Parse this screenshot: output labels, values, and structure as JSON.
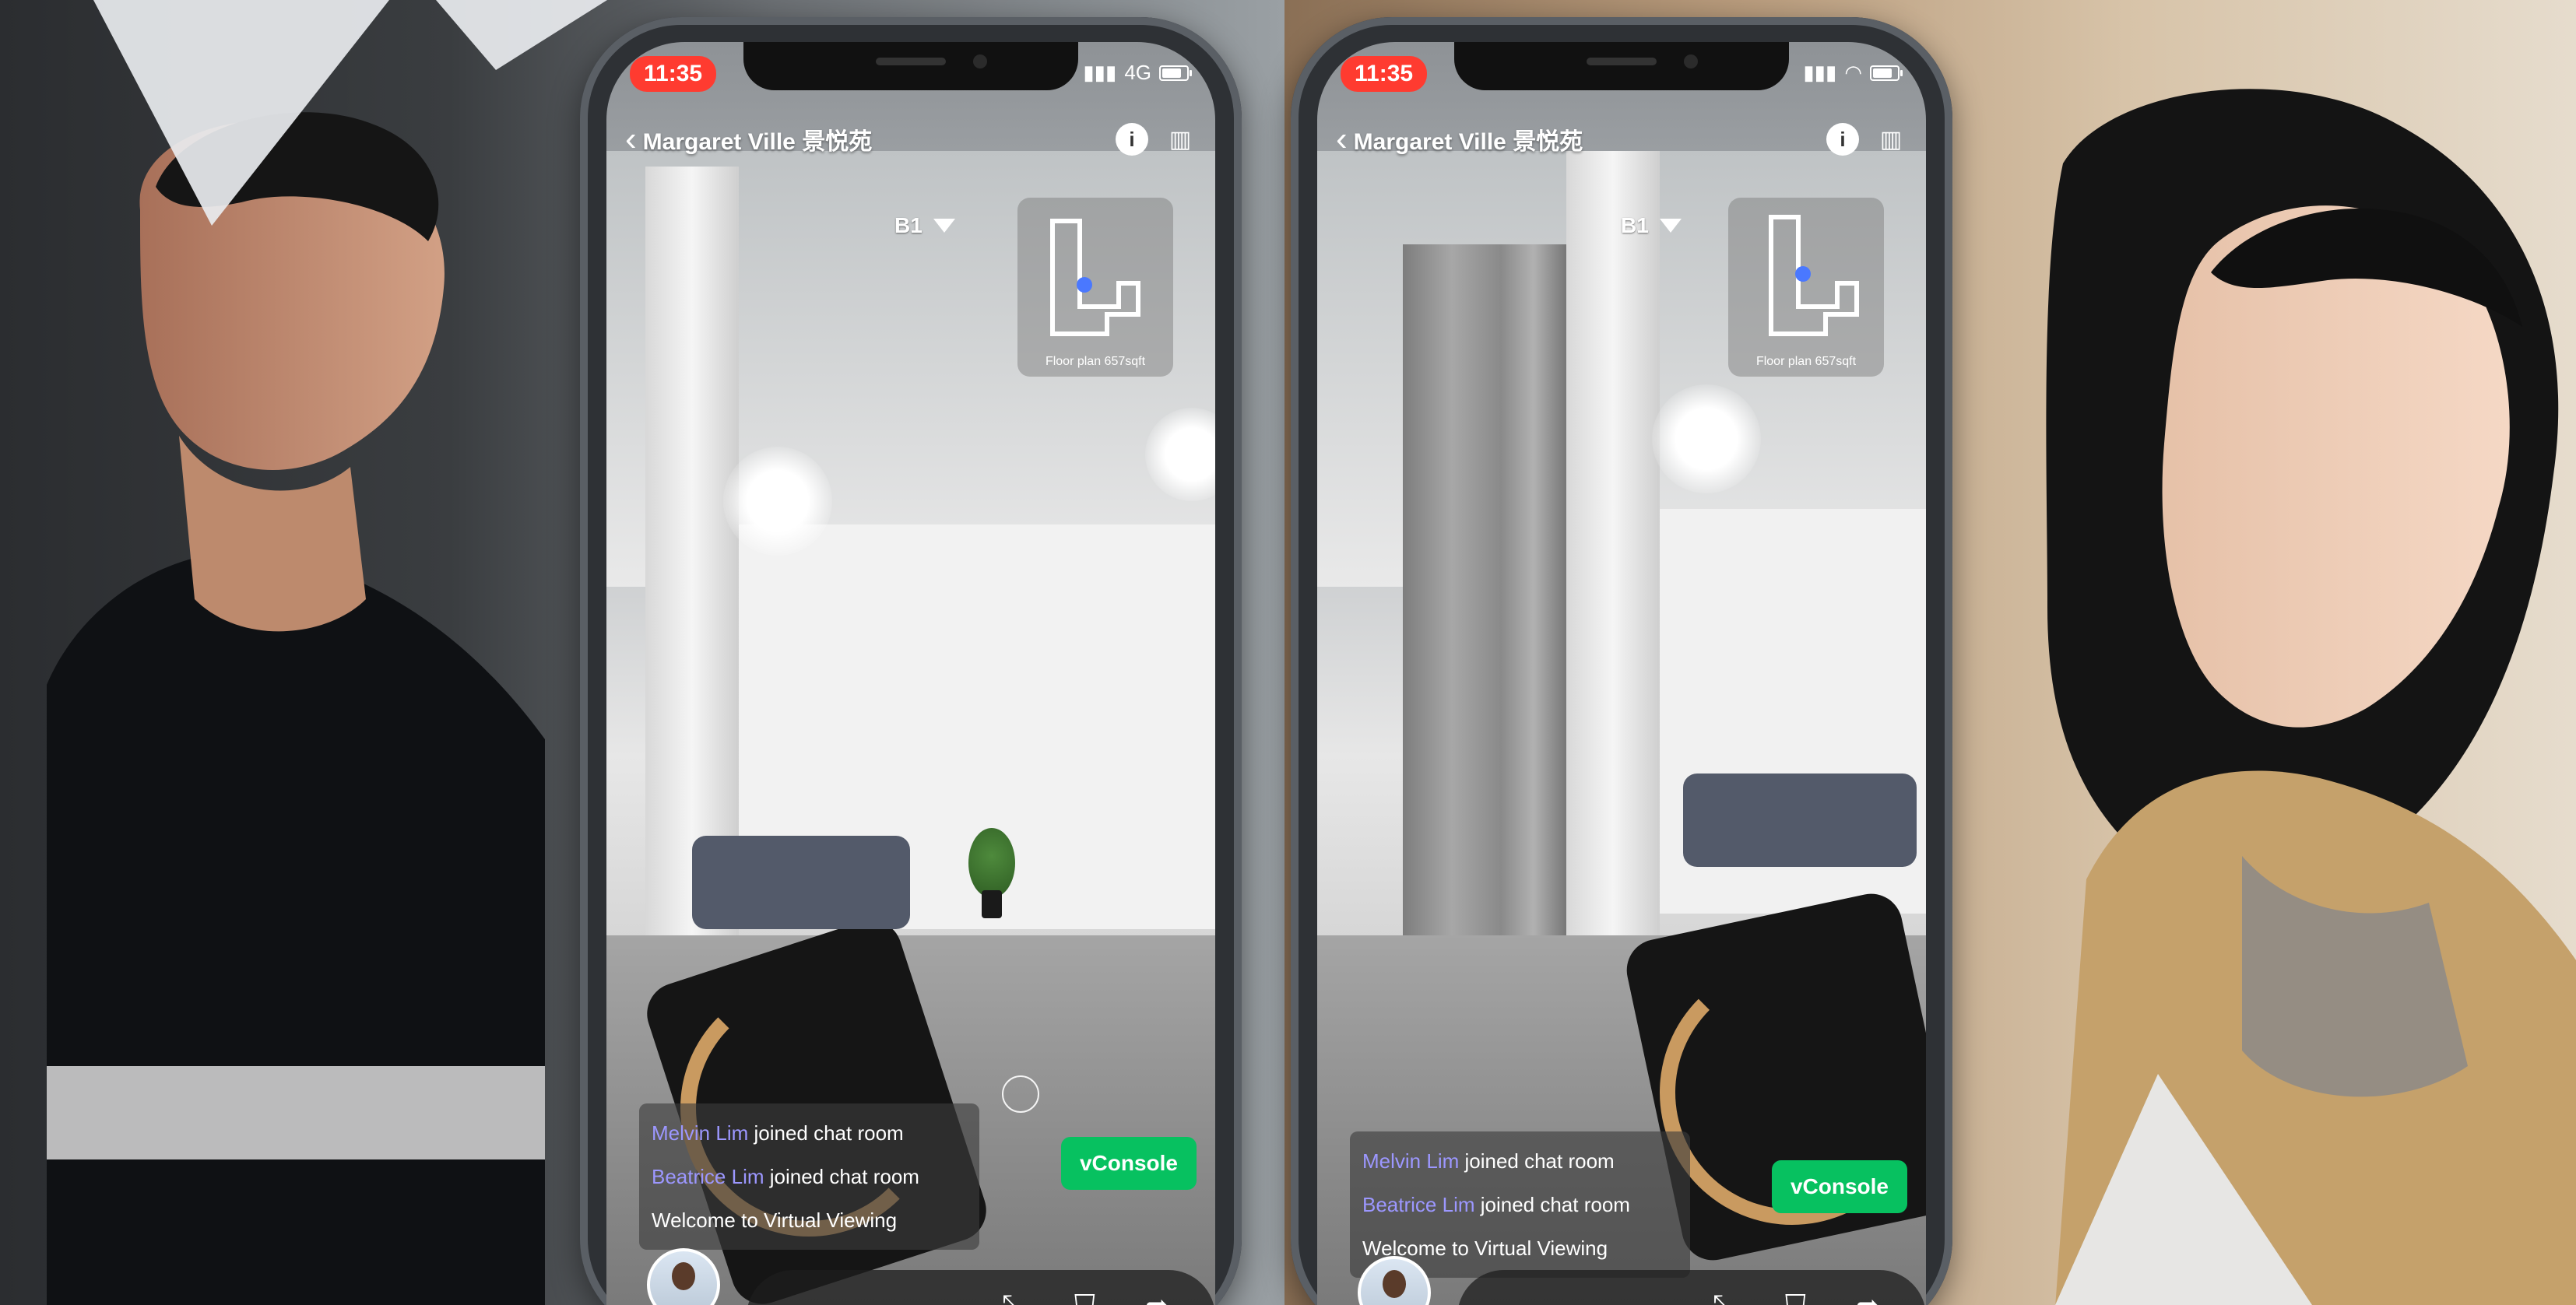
{
  "scene": {
    "left_phone": {
      "status": {
        "time": "11:35",
        "network": "4G"
      },
      "header": {
        "title": "Margaret Ville 景悦苑"
      },
      "floor_label": "B1",
      "minimap": {
        "caption": "Floor plan 657sqft"
      },
      "chat": [
        {
          "name": "Melvin Lim",
          "text": " joined chat room"
        },
        {
          "name": "Beatrice Lim",
          "text": " joined chat room"
        },
        {
          "name": "",
          "text": "Welcome to Virtual Viewing"
        }
      ],
      "vconsole": "vConsole"
    },
    "right_phone": {
      "status": {
        "time": "11:35"
      },
      "header": {
        "title": "Margaret Ville 景悦苑"
      },
      "floor_label": "B1",
      "minimap": {
        "caption": "Floor plan 657sqft"
      },
      "chat": [
        {
          "name": "Melvin Lim",
          "text": " joined chat room"
        },
        {
          "name": "Beatrice Lim",
          "text": " joined chat room"
        },
        {
          "name": "",
          "text": "Welcome to Virtual Viewing"
        }
      ],
      "vconsole": "vConsole"
    }
  },
  "icons": {
    "back": "chevron-left-icon",
    "info": "info-icon",
    "map": "map-icon",
    "wifi": "wifi-icon",
    "battery": "battery-icon",
    "signal": "signal-icon"
  },
  "colors": {
    "status_time_bg": "#ff3b30",
    "vconsole_green": "#07c160",
    "chat_name": "#9c97ff"
  }
}
